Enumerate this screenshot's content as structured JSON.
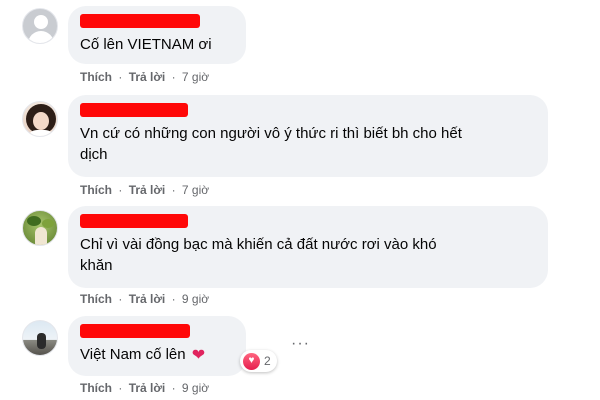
{
  "labels": {
    "like": "Thích",
    "reply": "Trả lời",
    "separator": "·"
  },
  "comments": [
    {
      "avatar": "default-user-icon",
      "text": "Cố lên VIETNAM ơi",
      "time": "7 giờ"
    },
    {
      "avatar": "girl-photo-avatar",
      "text_lines": [
        "Vn cứ có những con người vô ý thức ri thì biết bh cho hết",
        "dịch"
      ],
      "time": "7 giờ"
    },
    {
      "avatar": "nature-photo-avatar",
      "text_lines": [
        "Chỉ vì vài đồng bạc mà khiến cả đất nước rơi vào khó",
        "khăn"
      ],
      "time": "9 giờ"
    },
    {
      "avatar": "sky-photo-avatar",
      "text": "Việt Nam cố lên",
      "emoji": "❤",
      "reaction": {
        "icon": "love-reaction-icon",
        "count": "2"
      },
      "more_icon": "···",
      "time": "9 giờ"
    }
  ],
  "colors": {
    "bubble": "#f0f2f5",
    "redaction": "#ff0808",
    "meta_text": "#65676b",
    "love": "#e61e4d"
  }
}
